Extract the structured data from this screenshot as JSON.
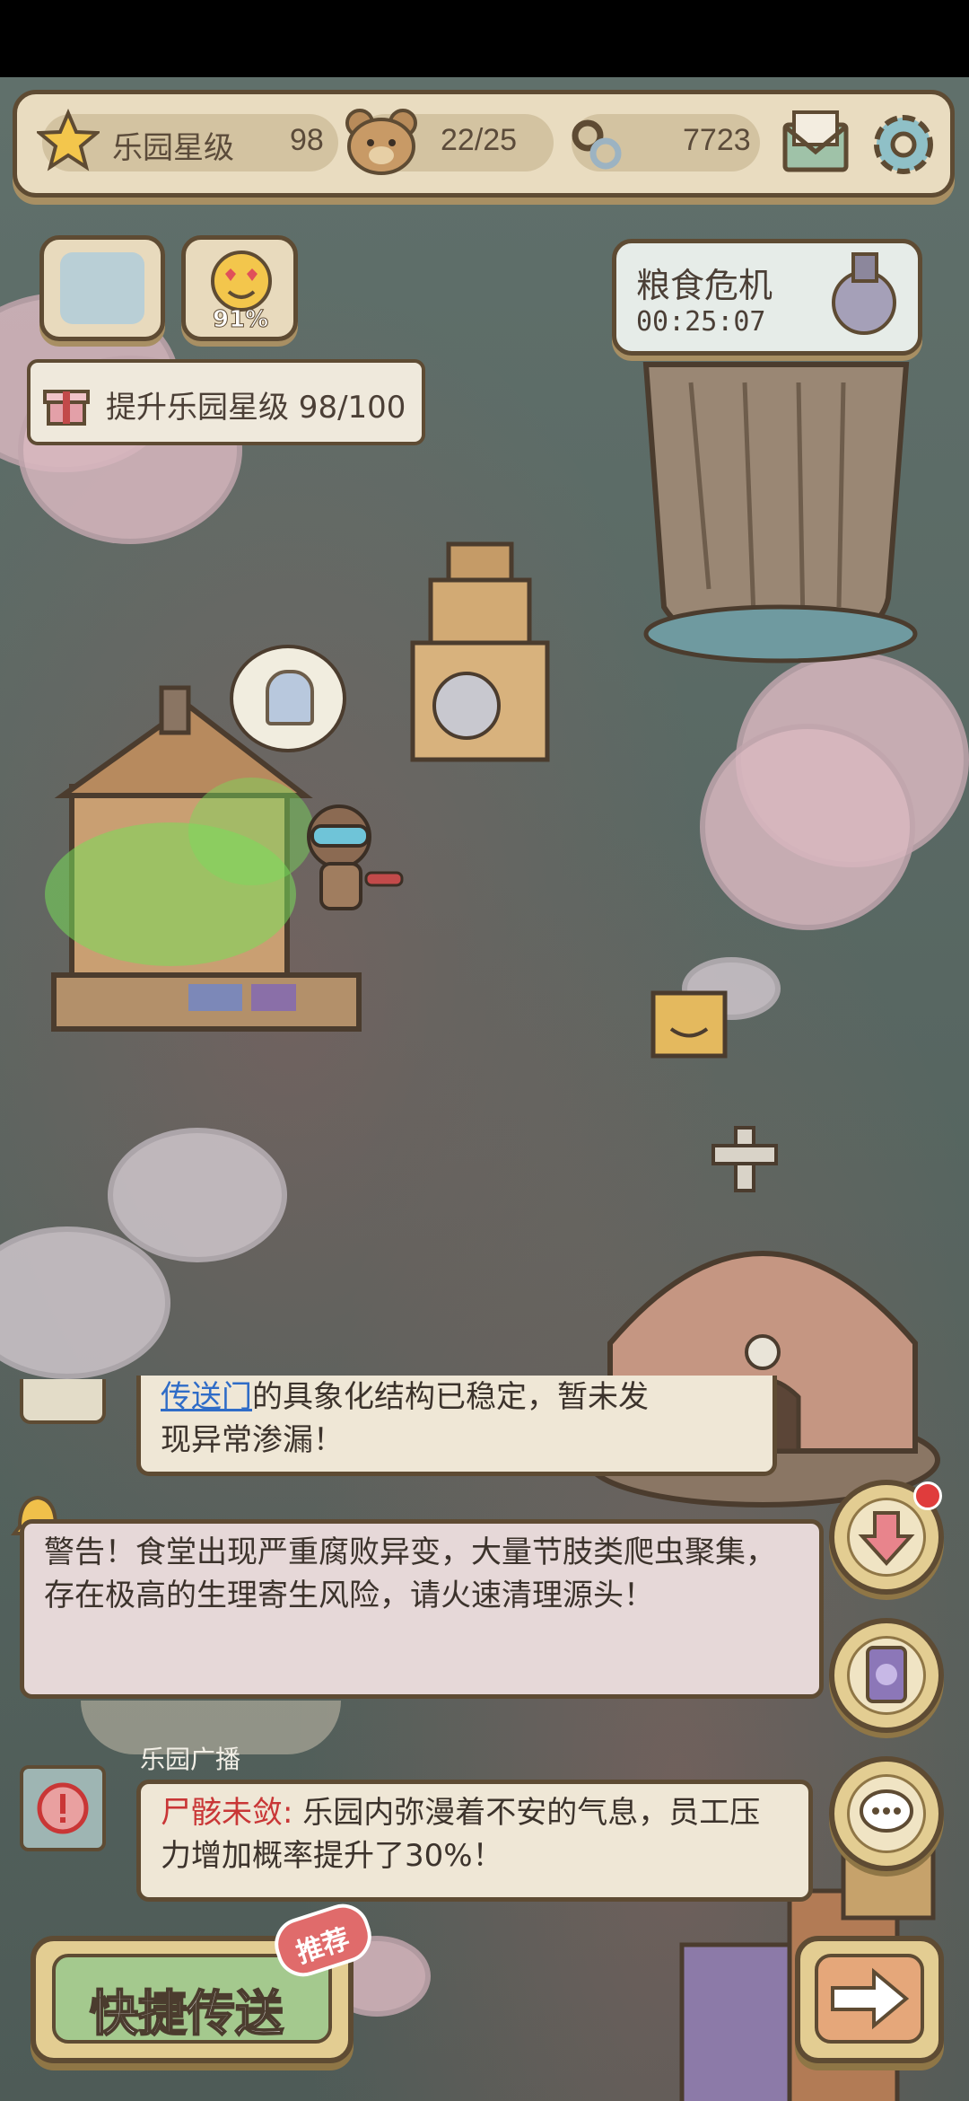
{
  "topbar": {
    "park_star_label": "乐园星级",
    "park_star_value": "98",
    "staff_count": "22/25",
    "currency_value": "7723",
    "icons": [
      "star-icon",
      "bear-icon",
      "chain-icon",
      "mail-icon",
      "gear-icon"
    ]
  },
  "happiness": {
    "percent": "91%"
  },
  "goal": {
    "text": "提升乐园星级 98/100"
  },
  "event": {
    "title": "粮食危机",
    "timer": "00:25:07"
  },
  "messages": {
    "partial_link": "传送门",
    "partial_rest": "的具象化结构已稳定，暂未发",
    "partial_line2": "现异常渗漏！",
    "warning": "警告！食堂出现严重腐败异变，大量节肢类爬虫聚集，存在极高的生理寄生风险，请火速清理源头！",
    "broadcast_label": "乐园广播",
    "alert_tag": "尸骸未敛:",
    "alert_text": "乐园内弥漫着不安的气息，员工压力增加概率提升了30%！"
  },
  "bottom": {
    "quick_teleport": "快捷传送",
    "recommend_tag": "推荐"
  },
  "colors": {
    "frame": "#5e4b33",
    "panel": "#e9dcc0",
    "accent_red": "#c93636",
    "link_blue": "#2f6cc7",
    "warning_bg": "#e6d8d8"
  }
}
